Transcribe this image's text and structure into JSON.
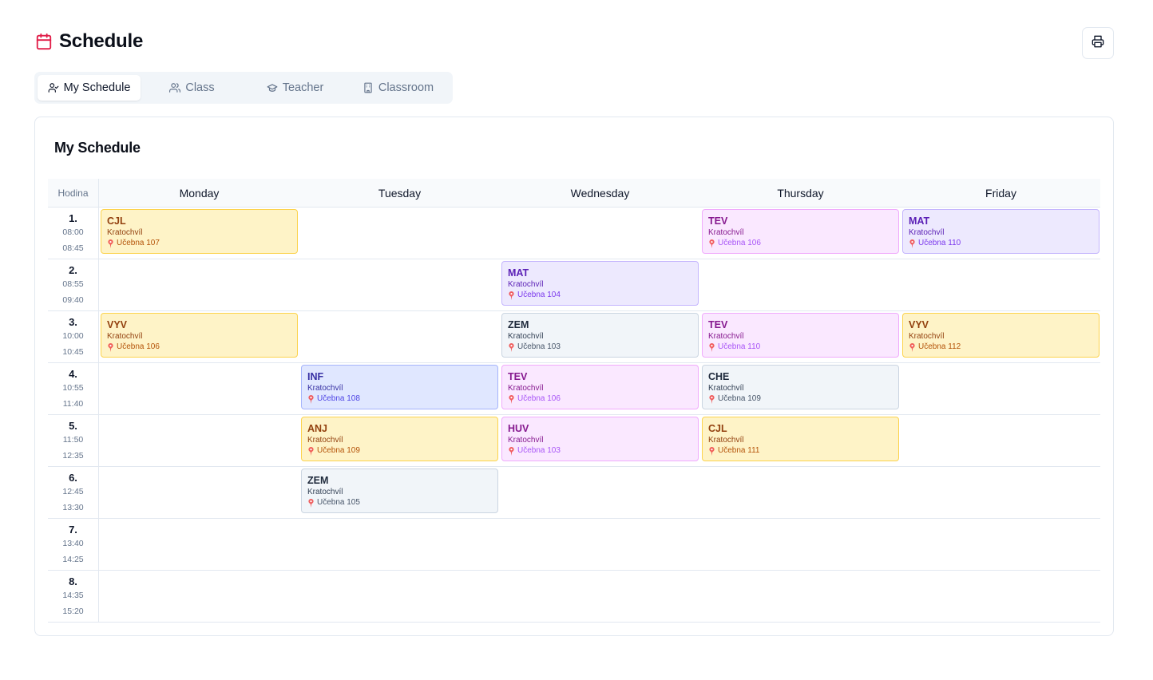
{
  "header": {
    "title": "Schedule"
  },
  "tabs": [
    {
      "label": "My Schedule",
      "icon": "user-check-icon",
      "active": true
    },
    {
      "label": "Class",
      "icon": "users-icon",
      "active": false
    },
    {
      "label": "Teacher",
      "icon": "graduation-cap-icon",
      "active": false
    },
    {
      "label": "Classroom",
      "icon": "building-icon",
      "active": false
    }
  ],
  "card": {
    "title": "My Schedule"
  },
  "table": {
    "hodina_label": "Hodina",
    "days": [
      "Monday",
      "Tuesday",
      "Wednesday",
      "Thursday",
      "Friday"
    ],
    "periods": [
      {
        "num": "1.",
        "start": "08:00",
        "end": "08:45"
      },
      {
        "num": "2.",
        "start": "08:55",
        "end": "09:40"
      },
      {
        "num": "3.",
        "start": "10:00",
        "end": "10:45"
      },
      {
        "num": "4.",
        "start": "10:55",
        "end": "11:40"
      },
      {
        "num": "5.",
        "start": "11:50",
        "end": "12:35"
      },
      {
        "num": "6.",
        "start": "12:45",
        "end": "13:30"
      },
      {
        "num": "7.",
        "start": "13:40",
        "end": "14:25"
      },
      {
        "num": "8.",
        "start": "14:35",
        "end": "15:20"
      }
    ],
    "lessons": [
      {
        "day": 0,
        "period": 0,
        "subject": "CJL",
        "teacher": "Kratochvíl",
        "room": "Učebna 107",
        "theme": "yellow"
      },
      {
        "day": 3,
        "period": 0,
        "subject": "TEV",
        "teacher": "Kratochvíl",
        "room": "Učebna 106",
        "theme": "pink"
      },
      {
        "day": 4,
        "period": 0,
        "subject": "MAT",
        "teacher": "Kratochvíl",
        "room": "Učebna 110",
        "theme": "purple"
      },
      {
        "day": 2,
        "period": 1,
        "subject": "MAT",
        "teacher": "Kratochvíl",
        "room": "Učebna 104",
        "theme": "purple"
      },
      {
        "day": 0,
        "period": 2,
        "subject": "VYV",
        "teacher": "Kratochvíl",
        "room": "Učebna 106",
        "theme": "yellow"
      },
      {
        "day": 2,
        "period": 2,
        "subject": "ZEM",
        "teacher": "Kratochvíl",
        "room": "Učebna 103",
        "theme": "gray"
      },
      {
        "day": 3,
        "period": 2,
        "subject": "TEV",
        "teacher": "Kratochvíl",
        "room": "Učebna 110",
        "theme": "pink"
      },
      {
        "day": 4,
        "period": 2,
        "subject": "VYV",
        "teacher": "Kratochvíl",
        "room": "Učebna 112",
        "theme": "yellow"
      },
      {
        "day": 1,
        "period": 3,
        "subject": "INF",
        "teacher": "Kratochvíl",
        "room": "Učebna 108",
        "theme": "blue"
      },
      {
        "day": 2,
        "period": 3,
        "subject": "TEV",
        "teacher": "Kratochvíl",
        "room": "Učebna 106",
        "theme": "pink"
      },
      {
        "day": 3,
        "period": 3,
        "subject": "CHE",
        "teacher": "Kratochvíl",
        "room": "Učebna 109",
        "theme": "gray"
      },
      {
        "day": 1,
        "period": 4,
        "subject": "ANJ",
        "teacher": "Kratochvíl",
        "room": "Učebna 109",
        "theme": "yellow"
      },
      {
        "day": 2,
        "period": 4,
        "subject": "HUV",
        "teacher": "Kratochvíl",
        "room": "Učebna 103",
        "theme": "pink"
      },
      {
        "day": 3,
        "period": 4,
        "subject": "CJL",
        "teacher": "Kratochvíl",
        "room": "Učebna 111",
        "theme": "yellow"
      },
      {
        "day": 1,
        "period": 5,
        "subject": "ZEM",
        "teacher": "Kratochvíl",
        "room": "Učebna 105",
        "theme": "gray"
      }
    ]
  },
  "themes": {
    "yellow": {
      "bg": "#fef3c7",
      "border": "#fcd34d",
      "subject": "#92400e",
      "teacher": "#92400e",
      "room": "#b45309"
    },
    "pink": {
      "bg": "#fae8ff",
      "border": "#f0abfc",
      "subject": "#86198f",
      "teacher": "#86198f",
      "room": "#a855f7"
    },
    "purple": {
      "bg": "#ede9fe",
      "border": "#c4b5fd",
      "subject": "#5b21b6",
      "teacher": "#5b21b6",
      "room": "#7c3aed"
    },
    "gray": {
      "bg": "#f1f5f9",
      "border": "#cbd5e1",
      "subject": "#1e293b",
      "teacher": "#334155",
      "room": "#475569"
    },
    "blue": {
      "bg": "#e0e7ff",
      "border": "#a5b4fc",
      "subject": "#3730a3",
      "teacher": "#3730a3",
      "room": "#4f46e5"
    }
  },
  "colors": {
    "accent": "#e11d48",
    "pin": "#ef4444",
    "border": "#e2e8f0"
  },
  "icons": {
    "title": "calendar-icon",
    "print": "printer-icon",
    "room": "map-pin-icon"
  }
}
